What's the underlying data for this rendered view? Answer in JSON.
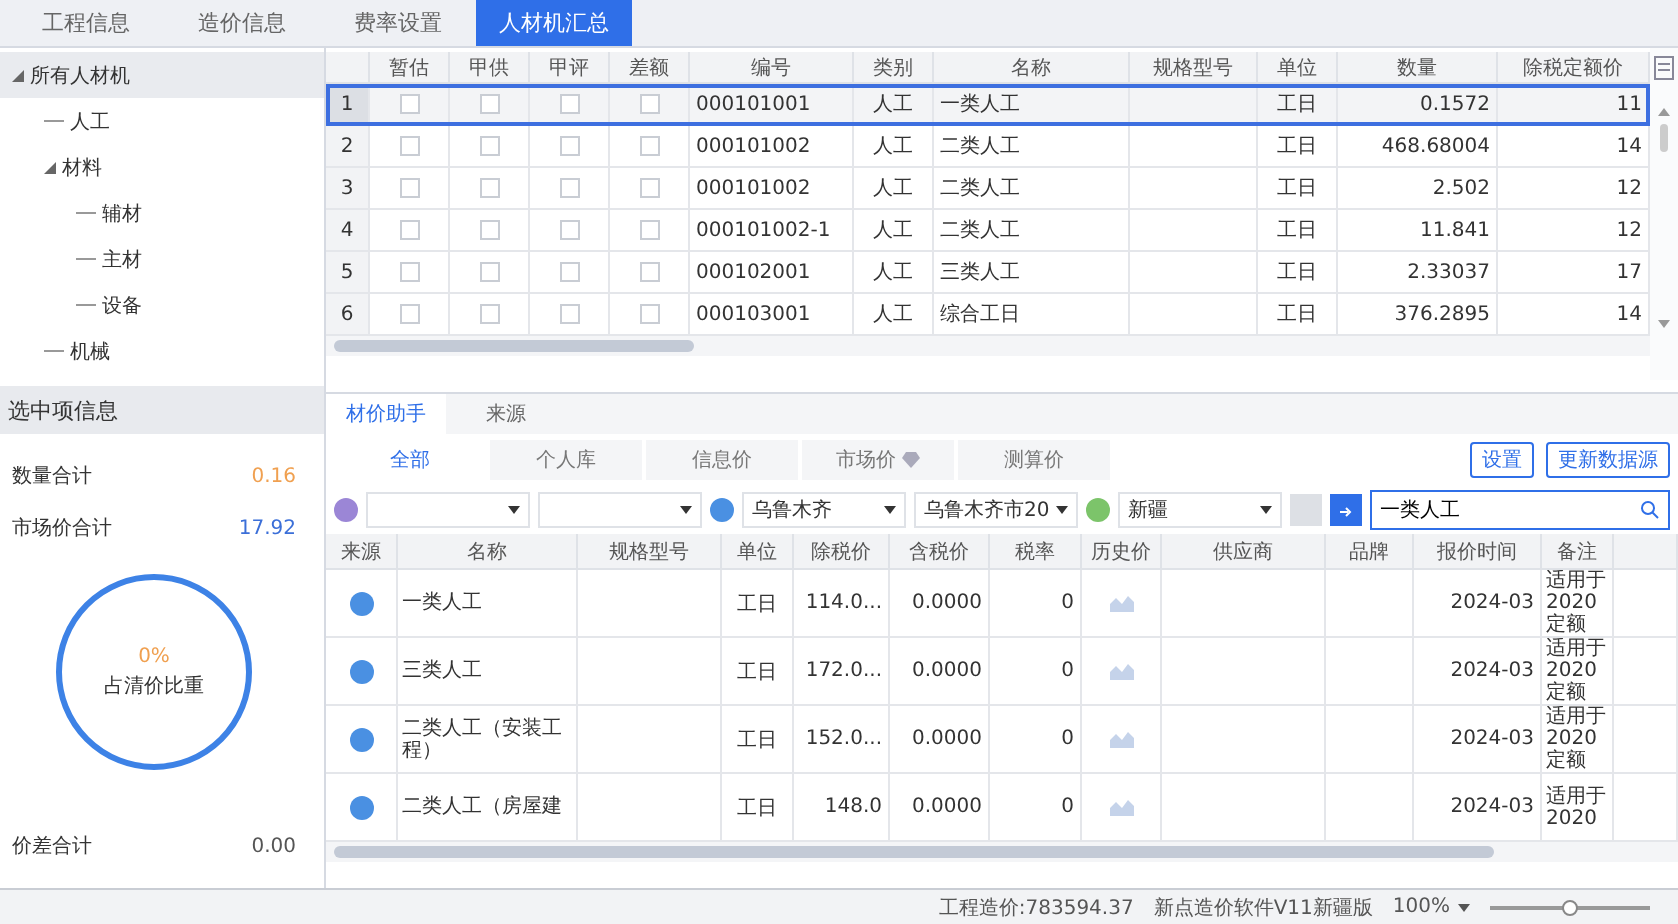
{
  "tabs": [
    {
      "label": "工程信息",
      "selected": false
    },
    {
      "label": "造价信息",
      "selected": false
    },
    {
      "label": "费率设置",
      "selected": false
    },
    {
      "label": "人材机汇总",
      "selected": true
    }
  ],
  "tree": {
    "label": "所有人材机",
    "expanded": true,
    "selected": true,
    "children": [
      {
        "label": "人工",
        "selected": false
      },
      {
        "label": "材料",
        "expanded": true,
        "selected": false,
        "children": [
          {
            "label": "辅材",
            "selected": false
          },
          {
            "label": "主材",
            "selected": false
          },
          {
            "label": "设备",
            "selected": false
          }
        ]
      },
      {
        "label": "机械",
        "selected": false
      }
    ]
  },
  "selection_info": {
    "title": "选中项信息",
    "stats": [
      {
        "label": "数量合计",
        "value": "0.16",
        "color": "#f0a050"
      },
      {
        "label": "市场价合计",
        "value": "17.92",
        "color": "#3b6fd8"
      }
    ],
    "ring": {
      "percent": "0%",
      "label": "占清价比重"
    },
    "footer": {
      "label": "价差合计",
      "value": "0.00"
    }
  },
  "top_table": {
    "columns": [
      "暂估",
      "甲供",
      "甲评",
      "差额",
      "编号",
      "类别",
      "名称",
      "规格型号",
      "单位",
      "数量",
      "除税定额价"
    ],
    "rows": [
      {
        "number": "1",
        "selected": true,
        "checkboxes": [
          false,
          false,
          false,
          false
        ],
        "code": "000101001",
        "type": "人工",
        "name": "一类人工",
        "unit": "工日",
        "quantity": "0.1572",
        "price": "11"
      },
      {
        "number": "2",
        "selected": false,
        "checkboxes": [
          false,
          false,
          false,
          false
        ],
        "code": "000101002",
        "type": "人工",
        "name": "二类人工",
        "unit": "工日",
        "quantity": "468.68004",
        "price": "14"
      },
      {
        "number": "3",
        "selected": false,
        "checkboxes": [
          false,
          false,
          false,
          false
        ],
        "code": "000101002",
        "type": "人工",
        "name": "二类人工",
        "unit": "工日",
        "quantity": "2.502",
        "price": "12"
      },
      {
        "number": "4",
        "selected": false,
        "checkboxes": [
          false,
          false,
          false,
          false
        ],
        "code": "000101002-1",
        "type": "人工",
        "name": "二类人工",
        "unit": "工日",
        "quantity": "11.841",
        "price": "12"
      },
      {
        "number": "5",
        "selected": false,
        "checkboxes": [
          false,
          false,
          false,
          false
        ],
        "code": "000102001",
        "type": "人工",
        "name": "三类人工",
        "unit": "工日",
        "quantity": "2.33037",
        "price": "17"
      },
      {
        "number": "6",
        "selected": false,
        "checkboxes": [
          false,
          false,
          false,
          false
        ],
        "code": "000103001",
        "type": "人工",
        "name": "综合工日",
        "unit": "工日",
        "quantity": "376.2895",
        "price": "14"
      }
    ]
  },
  "helper": {
    "panel_tabs": [
      {
        "label": "材价助手",
        "selected": true
      },
      {
        "label": "来源",
        "selected": false
      }
    ],
    "source_tabs": [
      {
        "label": "全部",
        "selected": true
      },
      {
        "label": "个人库",
        "selected": false
      },
      {
        "label": "信息价",
        "selected": false
      },
      {
        "label": "市场价",
        "selected": false,
        "gem": true
      },
      {
        "label": "测算价",
        "selected": false
      }
    ],
    "buttons": [
      "设置",
      "更新数据源"
    ],
    "filters": [
      {
        "kind": "dropdown",
        "color": "#9b86d6"
      },
      {
        "kind": "dropdown"
      },
      {
        "kind": "dropdown",
        "color": "#4a90e2",
        "value": "乌鲁木齐"
      },
      {
        "kind": "dropdown",
        "value": "乌鲁木齐市20"
      },
      {
        "kind": "dropdown",
        "color": "#7cc46a",
        "value": "新疆"
      }
    ],
    "search": {
      "value": "一类人工"
    },
    "price_table": {
      "columns": [
        "来源",
        "名称",
        "规格型号",
        "单位",
        "除税价",
        "含税价",
        "税率",
        "历史价",
        "供应商",
        "品牌",
        "报价时间",
        "备注"
      ],
      "rows": [
        {
          "name": "一类人工",
          "unit": "工日",
          "price_ex_tax": "114.0...",
          "price_inc_tax": "0.0000",
          "tax_rate": "0",
          "quote_time": "2024-03",
          "remark": "适用于2020定额"
        },
        {
          "name": "三类人工",
          "unit": "工日",
          "price_ex_tax": "172.0...",
          "price_inc_tax": "0.0000",
          "tax_rate": "0",
          "quote_time": "2024-03",
          "remark": "适用于2020定额"
        },
        {
          "name": "二类人工（安装工程）",
          "unit": "工日",
          "price_ex_tax": "152.0...",
          "price_inc_tax": "0.0000",
          "tax_rate": "0",
          "quote_time": "2024-03",
          "remark": "适用于2020定额"
        },
        {
          "name": "二类人工（房屋建",
          "unit": "工日",
          "price_ex_tax": "148.0",
          "price_inc_tax": "0.0000",
          "tax_rate": "0",
          "quote_time": "2024-03",
          "remark": "适用于2020"
        }
      ]
    }
  },
  "status_bar": {
    "cost": "工程造价:783594.37",
    "version": "新点造价软件V11新疆版",
    "zoom": "100%",
    "zoom_level": {
      "level": 0.5
    }
  }
}
